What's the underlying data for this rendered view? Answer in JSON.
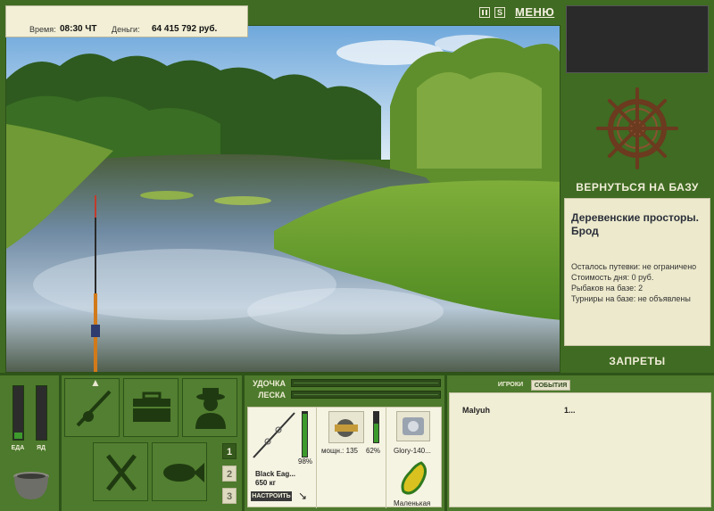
{
  "status": {
    "time_label": "Время:",
    "time_value": "08:30 ЧТ",
    "money_label": "Деньги:",
    "money_value": "64 415 792 руб."
  },
  "top_controls": {
    "sound_label": "S",
    "menu_label": "МЕНЮ"
  },
  "right_panel": {
    "return_label": "ВЕРНУТЬСЯ НА БАЗУ",
    "location_title": "Деревенские просторы. Брод",
    "info": [
      "Осталось путевки: не ограничено",
      "Стоимость дня: 0 руб.",
      "Рыбаков на базе: 2",
      "Турниры на базе: не объявлены"
    ],
    "bans_label": "ЗАПРЕТЫ"
  },
  "meters": [
    {
      "label": "ЕДА",
      "level": 0.12,
      "color": "#3d9a2c"
    },
    {
      "label": "ЯД",
      "level": 0.0,
      "color": "#3d9a2c"
    }
  ],
  "tools": {
    "tabs": [
      "1",
      "2",
      "3"
    ],
    "active_tab": "1"
  },
  "gauges": {
    "rod_label": "УДОЧКА",
    "line_label": "ЛЕСКА"
  },
  "gear": {
    "rod_name": "Black Eag...",
    "rod_weight": "650 кг",
    "rod_percent": "98%",
    "setup_label": "НАСТРОИТЬ",
    "reel_label": "мощн.: 135",
    "reel_percent": "62%",
    "line_name": "Glory-140...",
    "lure_name": "Маленькая"
  },
  "events": {
    "tab_players": "ИГРОКИ",
    "tab_events": "СОБЫТИЯ",
    "rows": [
      {
        "name": "Malyuh",
        "value": "1..."
      }
    ]
  }
}
